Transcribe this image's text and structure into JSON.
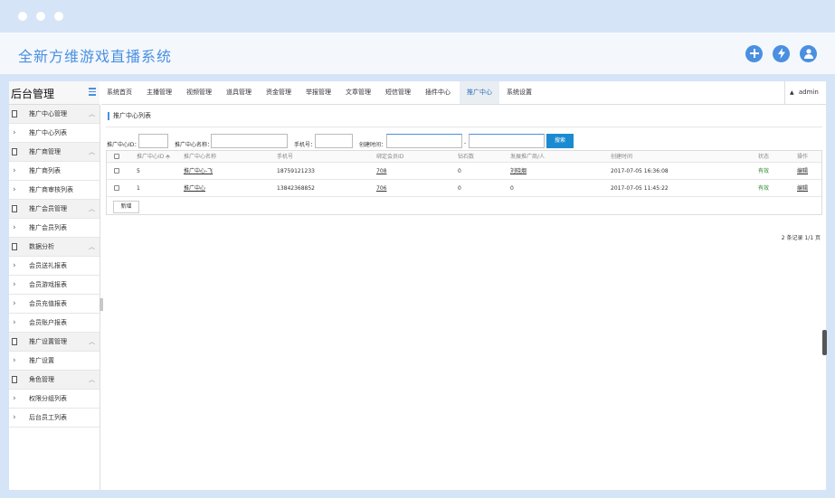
{
  "app": {
    "title": "全新方维游戏直播系统"
  },
  "header_icons": [
    "plus-icon",
    "lightning-icon",
    "user-icon"
  ],
  "sidebar": {
    "title": "后台管理",
    "items": [
      {
        "type": "group",
        "label": "推广中心管理"
      },
      {
        "type": "item",
        "label": "推广中心列表"
      },
      {
        "type": "group",
        "label": "推广商管理"
      },
      {
        "type": "item",
        "label": "推广商列表"
      },
      {
        "type": "item",
        "label": "推广商审核列表"
      },
      {
        "type": "group",
        "label": "推广会员管理"
      },
      {
        "type": "item",
        "label": "推广会员列表"
      },
      {
        "type": "group",
        "label": "数据分析"
      },
      {
        "type": "item",
        "label": "会员送礼报表"
      },
      {
        "type": "item",
        "label": "会员游戏报表"
      },
      {
        "type": "item",
        "label": "会员充值报表"
      },
      {
        "type": "item",
        "label": "会员账户报表"
      },
      {
        "type": "group",
        "label": "推广设置管理"
      },
      {
        "type": "item",
        "label": "推广设置"
      },
      {
        "type": "group",
        "label": "角色管理"
      },
      {
        "type": "item",
        "label": "权限分组列表"
      },
      {
        "type": "item",
        "label": "后台员工列表"
      }
    ]
  },
  "topnav": {
    "items": [
      "系统首页",
      "主播管理",
      "视频管理",
      "道具管理",
      "资金管理",
      "举报管理",
      "文章管理",
      "短信管理",
      "插件中心",
      "推广中心",
      "系统设置"
    ],
    "active": "推广中心",
    "user": "admin"
  },
  "breadcrumb": "推广中心列表",
  "filters": {
    "id_label": "推广中心ID：",
    "name_label": "推广中心名称：",
    "phone_label": "手机号：",
    "time_label": "创建时间：",
    "range_sep": "-",
    "search_button": "搜索"
  },
  "table": {
    "columns": [
      "推广中心ID",
      "推广中心名称",
      "手机号",
      "绑定会员ID",
      "钻石数",
      "发展推广商/人",
      "创建时间",
      "状态",
      "操作"
    ],
    "rows": [
      {
        "id": "5",
        "name": "推广中心-飞",
        "phone": "18759121233",
        "member_id": "708",
        "diamonds": "0",
        "agents": "刘晓烟",
        "created": "2017-07-05 16:36:08",
        "status": "有效",
        "action": "编辑"
      },
      {
        "id": "1",
        "name": "推广中心",
        "phone": "13842368852",
        "member_id": "706",
        "diamonds": "0",
        "agents": "0",
        "created": "2017-07-05 11:45:22",
        "status": "有效",
        "action": "编辑"
      }
    ],
    "add_button": "新增"
  },
  "pager": "2 条记录 1/1 页",
  "colors": {
    "accent": "#4a8fe0",
    "button": "#1a8bd0",
    "status_ok": "#2e8b2e"
  }
}
